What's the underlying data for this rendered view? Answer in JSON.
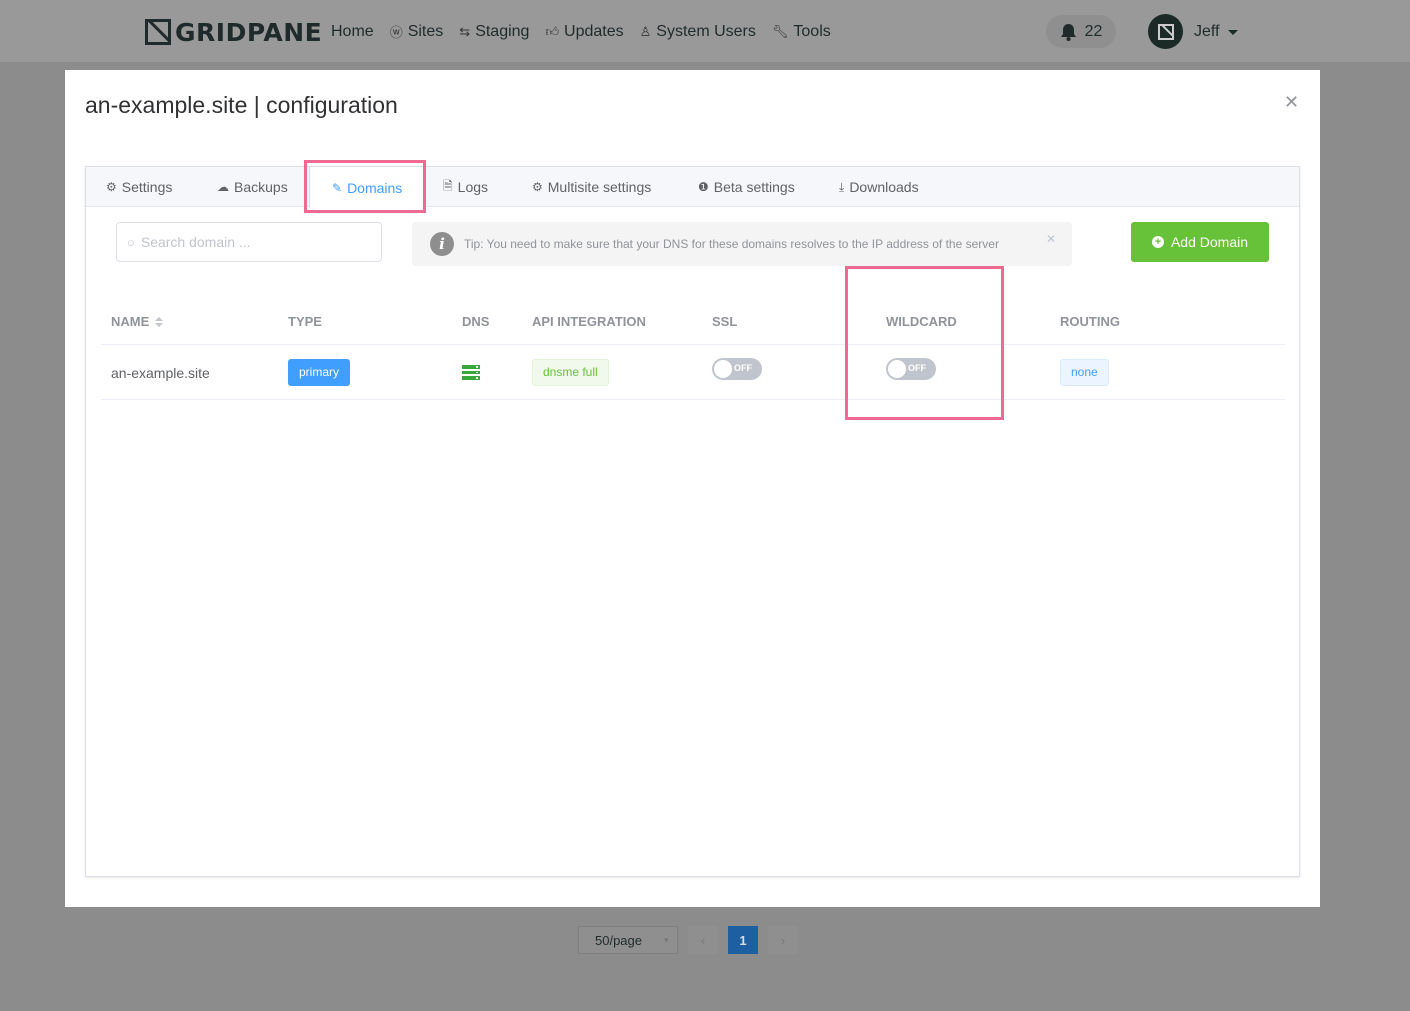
{
  "topbar": {
    "logo_text": "GRIDPANE",
    "nav": [
      {
        "label": "Home",
        "icon": ""
      },
      {
        "label": "Sites",
        "icon": "wordpress-icon"
      },
      {
        "label": "Staging",
        "icon": "retweet-icon"
      },
      {
        "label": "Updates",
        "icon": "thumbs-up-icon"
      },
      {
        "label": "System Users",
        "icon": "user-secret-icon"
      },
      {
        "label": "Tools",
        "icon": "wrench-icon"
      }
    ],
    "notification_count": "22",
    "user_name": "Jeff"
  },
  "modal": {
    "title": "an-example.site | configuration",
    "close_glyph": "✕"
  },
  "tabs": [
    {
      "label": "Settings",
      "icon": "gear-icon"
    },
    {
      "label": "Backups",
      "icon": "cloud-upload-icon"
    },
    {
      "label": "Domains",
      "icon": "edit-icon",
      "active": true
    },
    {
      "label": "Logs",
      "icon": "document-icon"
    },
    {
      "label": "Multisite settings",
      "icon": "gear-icon"
    },
    {
      "label": "Beta settings",
      "icon": "info-circle-icon"
    },
    {
      "label": "Downloads",
      "icon": "download-icon"
    }
  ],
  "search": {
    "placeholder": "Search domain ...",
    "value": ""
  },
  "tip": {
    "icon_glyph": "i",
    "text": "Tip: You need to make sure that your DNS for these domains resolves to the IP address of the server",
    "close_glyph": "✕"
  },
  "add_button": {
    "plus_glyph": "+",
    "label": "Add Domain"
  },
  "table": {
    "columns": [
      "NAME",
      "TYPE",
      "DNS",
      "API INTEGRATION",
      "SSL",
      "WILDCARD",
      "ROUTING"
    ],
    "rows": [
      {
        "name": "an-example.site",
        "type": "primary",
        "api_integration": "dnsme full",
        "ssl": "OFF",
        "wildcard": "OFF",
        "routing": "none"
      }
    ]
  },
  "pagination": {
    "page_size": "50/page",
    "prev_glyph": "‹",
    "next_glyph": "›",
    "current_page": "1"
  },
  "colors": {
    "highlight": "#ef6a92",
    "accent": "#409eff",
    "success": "#67c23a"
  }
}
